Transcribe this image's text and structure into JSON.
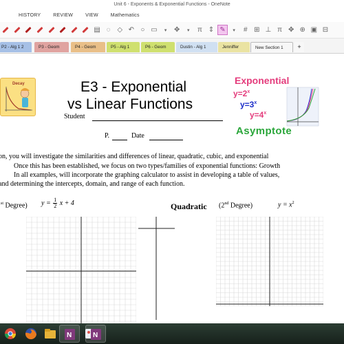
{
  "window": {
    "title": "Unit 6 - Exponents & Exponential Functions - OneNote"
  },
  "ribbon": {
    "tabs": [
      "HISTORY",
      "REVIEW",
      "VIEW",
      "Mathematics"
    ]
  },
  "toolbar": {
    "icons": [
      "pen-icon",
      "pen-icon",
      "pen-icon",
      "pen-icon",
      "pen-icon",
      "pen-icon",
      "pen-icon",
      "print-icon",
      "lasso-icon",
      "eraser-icon",
      "undo-icon",
      "shapes-icon",
      "pi-icon",
      "insert-space-icon",
      "color-icon",
      "grid-icon"
    ],
    "pi_label": "π",
    "accent_color": "#cf74c6"
  },
  "sections": {
    "tabs": [
      "P2 - Alg 1 2",
      "P3 - Geom",
      "P4 - Geom",
      "P5 - Alg 1",
      "P6 - Geom",
      "Dustin - Alg 1",
      "Jenniffer",
      "New Section 1"
    ],
    "add_label": "+",
    "colors": [
      "#a6c0e6",
      "#e0a3a0",
      "#e9bf88",
      "#cfe06f",
      "#cfe06f",
      "#d0e0f2",
      "#eae3a2",
      "#f7f7f7"
    ]
  },
  "page": {
    "decay_label": "Decay",
    "title_line1": "E3 - Exponential",
    "title_line2": "vs Linear Functions",
    "student_label": "Student",
    "period_label": "P.",
    "date_label": "Date",
    "exp_card": {
      "title": "Exponential",
      "eq1_base": "y=2",
      "eq1_exp": "x",
      "eq2_base": "y=3",
      "eq2_exp": "x",
      "eq3_base": "y=4",
      "eq3_exp": "x",
      "asymptote": "Asymptote"
    },
    "intro": [
      "on, you will investigate the similarities and differences of linear, quadratic, cubic, and exponential",
      "Once this has been established, we focus on two types/families of exponential functions:  Growth",
      "In all examples, will incorporate the graphing calculator to assist in developing a table of values,",
      "and determining the intercepts, domain, and range of each function."
    ],
    "linear_degree_sup": "st",
    "linear_degree_text": " Degree)",
    "linear_eq_prefix": "y =",
    "linear_eq_num": "1",
    "linear_eq_den": "2",
    "linear_eq_suffix": "x + 4",
    "quadratic_title": "Quadratic",
    "quadratic_degree_num": "(2",
    "quadratic_degree_sup": "nd",
    "quadratic_degree_text": " Degree)",
    "quadratic_eq_base": "y = x",
    "quadratic_eq_exp": "2"
  },
  "taskbar": {
    "apps": [
      "chrome-icon",
      "firefox-icon",
      "file-explorer-icon",
      "onenote-icon",
      "paint-icon",
      "onenote-icon"
    ]
  }
}
